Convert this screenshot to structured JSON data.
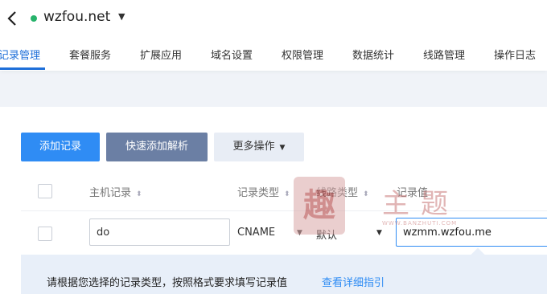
{
  "header": {
    "domain": "wzfou.net",
    "status_color": "#27b36b"
  },
  "tabs": [
    {
      "label": "记录管理",
      "active": true
    },
    {
      "label": "套餐服务"
    },
    {
      "label": "扩展应用"
    },
    {
      "label": "域名设置"
    },
    {
      "label": "权限管理"
    },
    {
      "label": "数据统计"
    },
    {
      "label": "线路管理"
    },
    {
      "label": "操作日志"
    }
  ],
  "toolbar": {
    "add_label": "添加记录",
    "quick_label": "快速添加解析",
    "more_label": "更多操作"
  },
  "table": {
    "columns": [
      "主机记录",
      "记录类型",
      "线路类型",
      "记录值"
    ]
  },
  "edit_row": {
    "host": "do",
    "type": "CNAME",
    "line": "默认",
    "value": "wzmm.wzfou.me"
  },
  "tip": {
    "text": "请根据您选择的记录类型，按照格式要求填写记录值",
    "link": "查看详细指引"
  },
  "watermark": {
    "seal": "趣",
    "title": "主题",
    "site": "WWW.BANZHUTI.COM"
  },
  "colors": {
    "accent": "#2f8cf4",
    "active_tab": "#1e6fd9"
  }
}
